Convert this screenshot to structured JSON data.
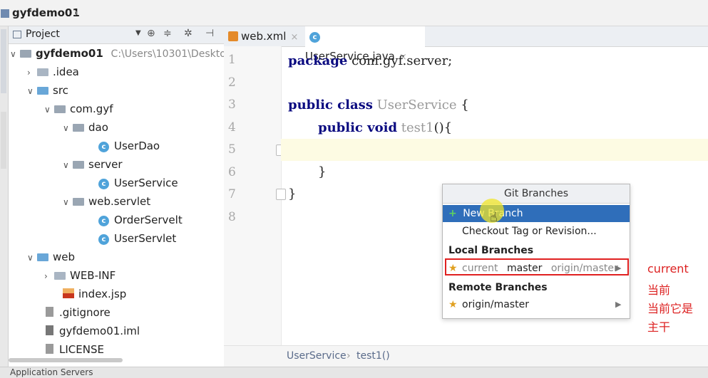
{
  "breadcrumb": {
    "project": "gyfdemo01"
  },
  "project_panel": {
    "header_label": "Project",
    "root_name": "gyfdemo01",
    "root_path": "C:\\Users\\10301\\Deskto",
    "items": [
      {
        "label": ".idea"
      },
      {
        "label": "src"
      },
      {
        "label": "com.gyf"
      },
      {
        "label": "dao"
      },
      {
        "label": "UserDao"
      },
      {
        "label": "server"
      },
      {
        "label": "UserService"
      },
      {
        "label": "web.servlet"
      },
      {
        "label": "OrderServelt"
      },
      {
        "label": "UserServlet"
      },
      {
        "label": "web"
      },
      {
        "label": "WEB-INF"
      },
      {
        "label": "index.jsp"
      },
      {
        "label": ".gitignore"
      },
      {
        "label": "gyfdemo01.iml"
      },
      {
        "label": "LICENSE"
      }
    ]
  },
  "editor": {
    "tabs": [
      {
        "label": "web.xml"
      },
      {
        "label": "UserService.java"
      }
    ],
    "line_numbers": [
      "1",
      "2",
      "3",
      "4",
      "5",
      "6",
      "7",
      "8"
    ],
    "code": {
      "l1_kw": "package",
      "l1_rest": " com.gyf.server;",
      "l3_kw": "public class",
      "l3_name": " UserService",
      "l3_brace": " {",
      "l4_kw": "public void",
      "l4_name": " test1",
      "l4_rest": "(){",
      "l6": "}",
      "l7": "}"
    },
    "breadcrumb_class": "UserService",
    "breadcrumb_method": "test1()"
  },
  "git_popup": {
    "title": "Git Branches",
    "new_branch": "New Branch",
    "checkout": "Checkout Tag or Revision...",
    "local_header": "Local Branches",
    "local_current_tag": "current",
    "local_branch": "master",
    "local_tracking": "origin/master",
    "remote_header": "Remote Branches",
    "remote_branch": "origin/master"
  },
  "annotation": {
    "line1": "current",
    "line2": "当前",
    "line3": "当前它是",
    "line4": "主干"
  },
  "bottom_bar": {
    "label": "Application Servers"
  },
  "colors": {
    "selection": "#2f6eba",
    "annotation": "#dd2222",
    "highlight_box": "#e02020"
  }
}
